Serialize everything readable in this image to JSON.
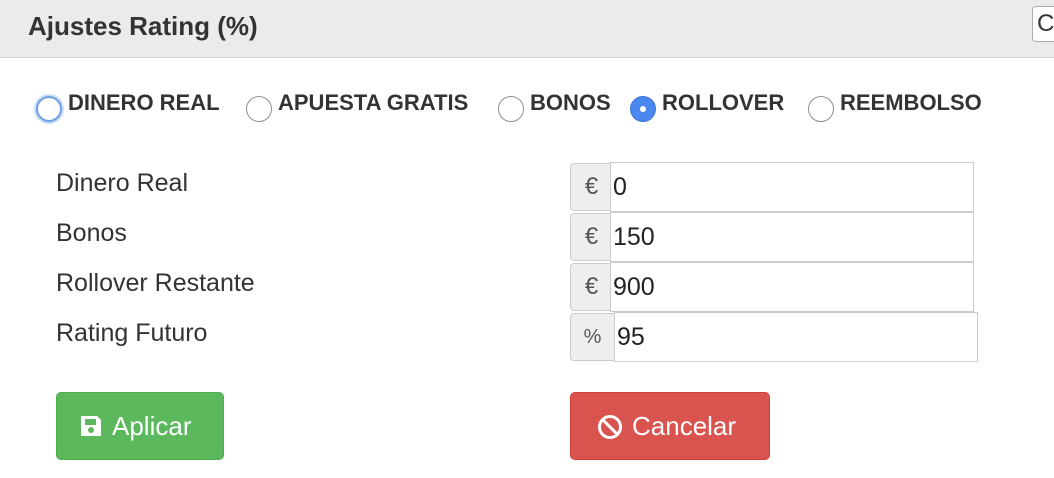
{
  "header": {
    "title": "Ajustes Rating (%)",
    "corner_button_label": "C"
  },
  "mode_options": [
    {
      "label": "DINERO REAL",
      "state": "focused"
    },
    {
      "label": "APUESTA GRATIS",
      "state": "unchecked"
    },
    {
      "label": "BONOS",
      "state": "unchecked"
    },
    {
      "label": "ROLLOVER",
      "state": "checked"
    },
    {
      "label": "REEMBOLSO",
      "state": "unchecked"
    }
  ],
  "fields": [
    {
      "label": "Dinero Real",
      "addon": "€",
      "value": "0"
    },
    {
      "label": "Bonos",
      "addon": "€",
      "value": "150"
    },
    {
      "label": "Rollover Restante",
      "addon": "€",
      "value": "900"
    },
    {
      "label": "Rating Futuro",
      "addon": "%",
      "value": "95"
    }
  ],
  "actions": {
    "apply_label": "Aplicar",
    "apply_icon": "floppy-disk-icon",
    "cancel_label": "Cancelar",
    "cancel_icon": "ban-icon"
  },
  "colors": {
    "apply_button": "#5cb85c",
    "cancel_button": "#d9534f",
    "radio_checked": "#4a87f0",
    "header_bg": "#ebebeb"
  }
}
